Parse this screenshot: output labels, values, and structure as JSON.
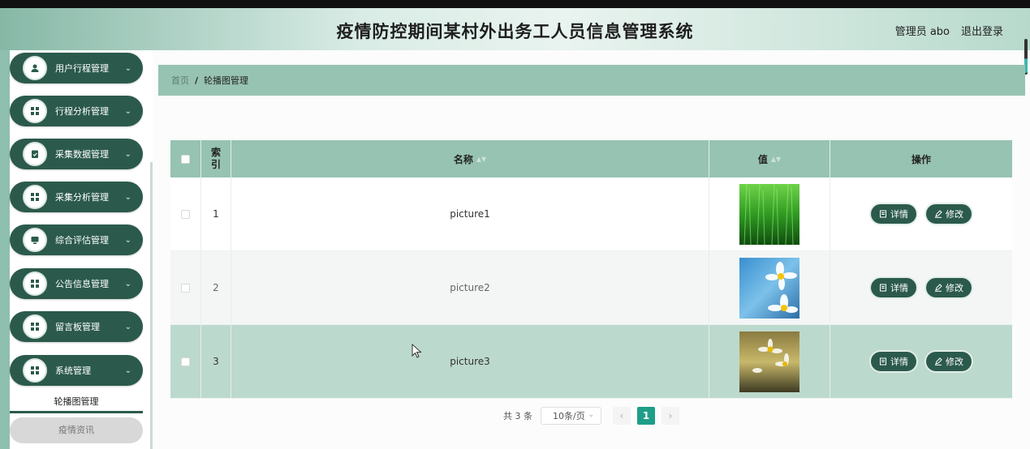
{
  "header": {
    "title": "疫情防控期间某村外出务工人员信息管理系统",
    "user": "管理员 abo",
    "logout": "退出登录"
  },
  "sidebar": {
    "items": [
      {
        "label": "用户行程管理",
        "icon": "user-icon"
      },
      {
        "label": "行程分析管理",
        "icon": "grid-icon"
      },
      {
        "label": "采集数据管理",
        "icon": "clipboard-icon"
      },
      {
        "label": "采集分析管理",
        "icon": "grid-icon"
      },
      {
        "label": "综合评估管理",
        "icon": "monitor-icon"
      },
      {
        "label": "公告信息管理",
        "icon": "grid-icon"
      },
      {
        "label": "留言板管理",
        "icon": "grid-icon"
      },
      {
        "label": "系统管理",
        "icon": "grid-icon"
      }
    ],
    "submenu_active": "轮播图管理",
    "news": "疫情资讯"
  },
  "breadcrumb": {
    "home": "首页",
    "separator": "/",
    "current": "轮播图管理"
  },
  "table": {
    "headers": {
      "index": "索引",
      "name": "名称",
      "value": "值",
      "ops": "操作"
    },
    "rows": [
      {
        "index": "1",
        "name": "picture1",
        "image": "grass"
      },
      {
        "index": "2",
        "name": "picture2",
        "image": "daisy-blue"
      },
      {
        "index": "3",
        "name": "picture3",
        "image": "daisy-yellow"
      }
    ],
    "detail_label": "详情",
    "edit_label": "修改"
  },
  "pagination": {
    "total": "共 3 条",
    "page_size": "10条/页",
    "current_page": "1"
  },
  "colors": {
    "accent": "#2b5a4c",
    "header_band": "#97c3b2",
    "page_active": "#1e9e88"
  }
}
